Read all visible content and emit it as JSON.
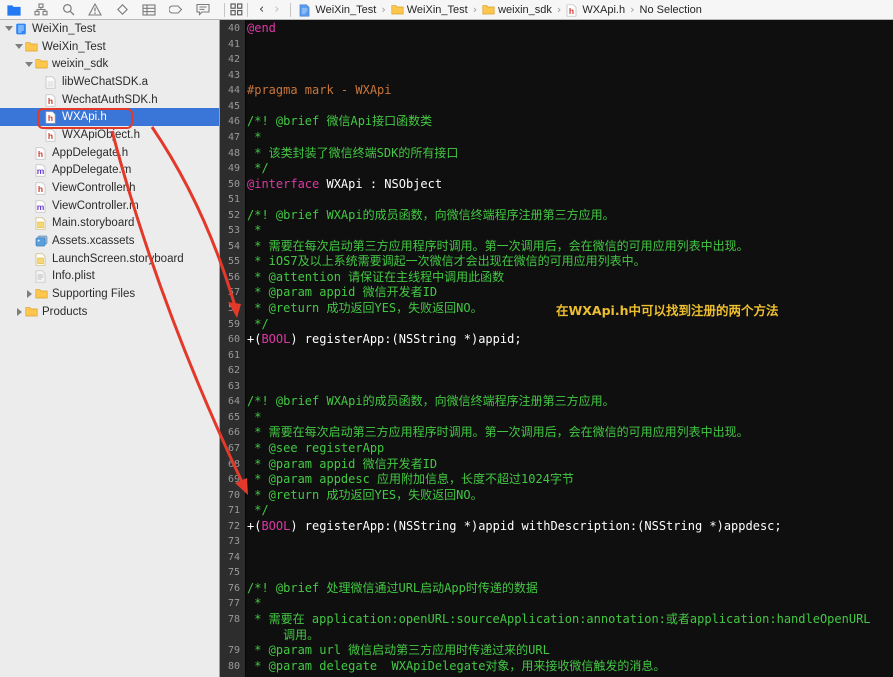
{
  "colors": {
    "sel": "#3a76d8",
    "cmt": "#43c843",
    "kw": "#de38a6",
    "pre": "#c9763a",
    "pln": "#ffffff",
    "yellow": "#edbf2e",
    "red": "#e2392a",
    "edbg": "#0f0f0f",
    "gutbg": "#2d2d2d"
  },
  "toolbar": {
    "navigators": [
      {
        "name": "project-navigator",
        "icon": "folder-nav",
        "active": true
      },
      {
        "name": "symbol-navigator",
        "icon": "symbol",
        "active": false
      },
      {
        "name": "find-navigator",
        "icon": "search",
        "active": false
      },
      {
        "name": "issue-navigator",
        "icon": "warning",
        "active": false
      },
      {
        "name": "test-navigator",
        "icon": "diamond",
        "active": false
      },
      {
        "name": "debug-navigator",
        "icon": "rows",
        "active": false
      },
      {
        "name": "breakpoint-navigator",
        "icon": "capsule",
        "active": false
      },
      {
        "name": "report-navigator",
        "icon": "bubble",
        "active": false
      }
    ],
    "back_label": "‹",
    "forward_label": "›"
  },
  "breadcrumb": {
    "separator": "›",
    "items": [
      {
        "label": "WeiXin_Test",
        "icon": "file-blue"
      },
      {
        "label": "WeiXin_Test",
        "icon": "folder"
      },
      {
        "label": "weixin_sdk",
        "icon": "folder"
      },
      {
        "label": "WXApi.h",
        "icon": "h"
      },
      {
        "label": "No Selection",
        "icon": null
      }
    ]
  },
  "sidebar": {
    "items": [
      {
        "label": "WeiXin_Test",
        "icon": "project",
        "level": 0,
        "disc": "open",
        "selected": false
      },
      {
        "label": "WeiXin_Test",
        "icon": "folder",
        "level": 1,
        "disc": "open",
        "selected": false
      },
      {
        "label": "weixin_sdk",
        "icon": "folder",
        "level": 2,
        "disc": "open",
        "selected": false
      },
      {
        "label": "libWeChatSDK.a",
        "icon": "archive",
        "level": 3,
        "disc": null,
        "selected": false
      },
      {
        "label": "WechatAuthSDK.h",
        "icon": "h",
        "level": 3,
        "disc": null,
        "selected": false
      },
      {
        "label": "WXApi.h",
        "icon": "h",
        "level": 3,
        "disc": null,
        "selected": true
      },
      {
        "label": "WXApiObject.h",
        "icon": "h",
        "level": 3,
        "disc": null,
        "selected": false
      },
      {
        "label": "AppDelegate.h",
        "icon": "h",
        "level": 2,
        "disc": null,
        "selected": false
      },
      {
        "label": "AppDelegate.m",
        "icon": "m",
        "level": 2,
        "disc": null,
        "selected": false
      },
      {
        "label": "ViewController.h",
        "icon": "h",
        "level": 2,
        "disc": null,
        "selected": false
      },
      {
        "label": "ViewController.m",
        "icon": "m",
        "level": 2,
        "disc": null,
        "selected": false
      },
      {
        "label": "Main.storyboard",
        "icon": "storyboard",
        "level": 2,
        "disc": null,
        "selected": false
      },
      {
        "label": "Assets.xcassets",
        "icon": "assets",
        "level": 2,
        "disc": null,
        "selected": false
      },
      {
        "label": "LaunchScreen.storyboard",
        "icon": "storyboard",
        "level": 2,
        "disc": null,
        "selected": false
      },
      {
        "label": "Info.plist",
        "icon": "plist",
        "level": 2,
        "disc": null,
        "selected": false
      },
      {
        "label": "Supporting Files",
        "icon": "folder",
        "level": 2,
        "disc": "closed",
        "selected": false
      },
      {
        "label": "Products",
        "icon": "folder",
        "level": 1,
        "disc": "closed",
        "selected": false
      }
    ]
  },
  "editor": {
    "lines": [
      {
        "n": "40",
        "s": [
          [
            "kw",
            "@end"
          ]
        ]
      },
      {
        "n": "41",
        "s": []
      },
      {
        "n": "42",
        "s": []
      },
      {
        "n": "43",
        "s": []
      },
      {
        "n": "44",
        "s": [
          [
            "pre",
            "#pragma mark - WXApi"
          ]
        ]
      },
      {
        "n": "45",
        "s": []
      },
      {
        "n": "46",
        "s": [
          [
            "cmt",
            "/*! @brief 微信Api接口函数类"
          ]
        ]
      },
      {
        "n": "47",
        "s": [
          [
            "cmt",
            " *"
          ]
        ]
      },
      {
        "n": "48",
        "s": [
          [
            "cmt",
            " * 该类封装了微信终端SDK的所有接口"
          ]
        ]
      },
      {
        "n": "49",
        "s": [
          [
            "cmt",
            " */"
          ]
        ]
      },
      {
        "n": "50",
        "s": [
          [
            "kw",
            "@interface"
          ],
          [
            "pln",
            " WXApi : NSObject"
          ]
        ]
      },
      {
        "n": "51",
        "s": []
      },
      {
        "n": "52",
        "s": [
          [
            "cmt",
            "/*! @brief WXApi的成员函数，向微信终端程序注册第三方应用。"
          ]
        ]
      },
      {
        "n": "53",
        "s": [
          [
            "cmt",
            " *"
          ]
        ]
      },
      {
        "n": "54",
        "s": [
          [
            "cmt",
            " * 需要在每次启动第三方应用程序时调用。第一次调用后，会在微信的可用应用列表中出现。"
          ]
        ]
      },
      {
        "n": "55",
        "s": [
          [
            "cmt",
            " * iOS7及以上系统需要调起一次微信才会出现在微信的可用应用列表中。"
          ]
        ]
      },
      {
        "n": "56",
        "s": [
          [
            "cmt",
            " * @attention 请保证在主线程中调用此函数"
          ]
        ]
      },
      {
        "n": "57",
        "s": [
          [
            "cmt",
            " * @param appid 微信开发者ID"
          ]
        ]
      },
      {
        "n": "58",
        "s": [
          [
            "cmt",
            " * @return 成功返回YES，失败返回NO。"
          ]
        ]
      },
      {
        "n": "59",
        "s": [
          [
            "cmt",
            " */"
          ]
        ]
      },
      {
        "n": "60",
        "s": [
          [
            "pln",
            "+("
          ],
          [
            "kw",
            "BOOL"
          ],
          [
            "pln",
            ") registerApp:(NSString *)appid;"
          ]
        ]
      },
      {
        "n": "61",
        "s": []
      },
      {
        "n": "62",
        "s": []
      },
      {
        "n": "63",
        "s": []
      },
      {
        "n": "64",
        "s": [
          [
            "cmt",
            "/*! @brief WXApi的成员函数，向微信终端程序注册第三方应用。"
          ]
        ]
      },
      {
        "n": "65",
        "s": [
          [
            "cmt",
            " *"
          ]
        ]
      },
      {
        "n": "66",
        "s": [
          [
            "cmt",
            " * 需要在每次启动第三方应用程序时调用。第一次调用后，会在微信的可用应用列表中出现。"
          ]
        ]
      },
      {
        "n": "67",
        "s": [
          [
            "cmt",
            " * @see registerApp"
          ]
        ]
      },
      {
        "n": "68",
        "s": [
          [
            "cmt",
            " * @param appid 微信开发者ID"
          ]
        ]
      },
      {
        "n": "69",
        "s": [
          [
            "cmt",
            " * @param appdesc 应用附加信息，长度不超过1024字节"
          ]
        ]
      },
      {
        "n": "70",
        "s": [
          [
            "cmt",
            " * @return 成功返回YES，失败返回NO。"
          ]
        ]
      },
      {
        "n": "71",
        "s": [
          [
            "cmt",
            " */"
          ]
        ]
      },
      {
        "n": "72",
        "s": [
          [
            "pln",
            "+("
          ],
          [
            "kw",
            "BOOL"
          ],
          [
            "pln",
            ") registerApp:(NSString *)appid withDescription:(NSString *)appdesc;"
          ]
        ]
      },
      {
        "n": "73",
        "s": []
      },
      {
        "n": "74",
        "s": []
      },
      {
        "n": "75",
        "s": []
      },
      {
        "n": "76",
        "s": [
          [
            "cmt",
            "/*! @brief 处理微信通过URL启动App时传递的数据"
          ]
        ]
      },
      {
        "n": "77",
        "s": [
          [
            "cmt",
            " *"
          ]
        ]
      },
      {
        "n": "78",
        "s": [
          [
            "cmt",
            " * 需要在 application:openURL:sourceApplication:annotation:或者application:handleOpenURL"
          ]
        ]
      },
      {
        "n": "",
        "s": [
          [
            "cmt",
            "     调用。"
          ]
        ]
      },
      {
        "n": "79",
        "s": [
          [
            "cmt",
            " * @param url 微信启动第三方应用时传递过来的URL"
          ]
        ]
      },
      {
        "n": "80",
        "s": [
          [
            "cmt",
            " * @param delegate  WXApiDelegate对象，用来接收微信触发的消息。"
          ]
        ]
      }
    ],
    "annotation": {
      "text": "在WXApi.h中可以找到注册的两个方法"
    }
  }
}
